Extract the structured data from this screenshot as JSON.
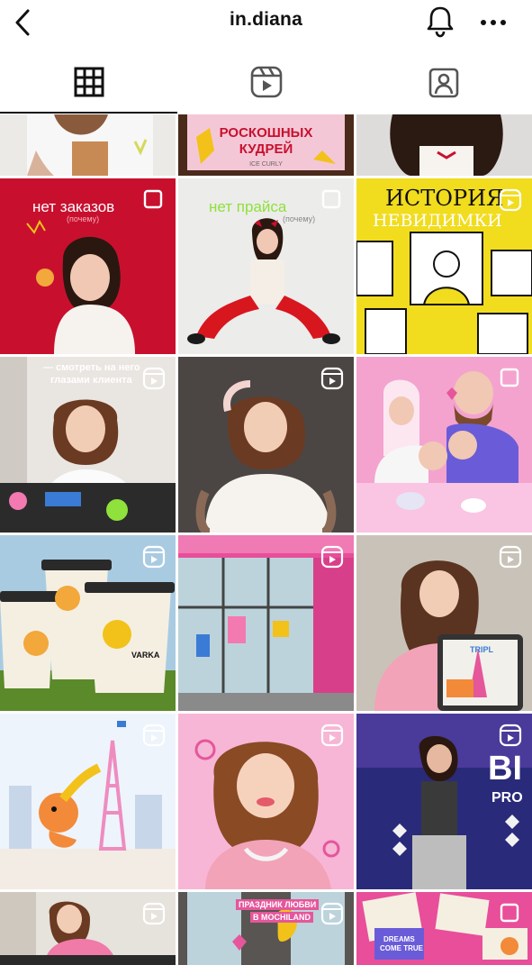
{
  "header": {
    "title": "in.diana",
    "back_icon": "chevron-left-icon",
    "bell_icon": "bell-icon",
    "more_icon": "more-dots-icon"
  },
  "tabs": [
    {
      "icon": "grid-icon",
      "active": true
    },
    {
      "icon": "reels-icon",
      "active": false
    },
    {
      "icon": "tagged-icon",
      "active": false
    }
  ],
  "posts": {
    "p1": {
      "text_top": "РОСКОШНЫХ",
      "text_bottom": "КУДРЕЙ",
      "small": "ICE CURLY"
    },
    "p3": {
      "title": "нет заказов",
      "sub": "(почему)"
    },
    "p4": {
      "title": "нет прайса",
      "sub": "(почему)"
    },
    "p5": {
      "line1": "ИСТОРИЯ",
      "line2": "НЕВИДИМКИ"
    },
    "p6": {
      "line1": "— смотреть на него",
      "line2": "глазами клиента"
    },
    "p10": {
      "brand": "VARKA"
    },
    "p12": {
      "tablet": "TRIPL"
    },
    "p15": {
      "big": "BI",
      "sub": "PRO"
    },
    "p17": {
      "line1": "ПРАЗДНИК ЛЮБВИ",
      "line2": "В MOCHILAND"
    },
    "p18": {
      "line1": "DREAMS",
      "line2": "COME TRUE"
    }
  },
  "colors": {
    "accent_red": "#c8102e",
    "pink": "#f4a3cf",
    "yellow": "#f1dc1e"
  }
}
